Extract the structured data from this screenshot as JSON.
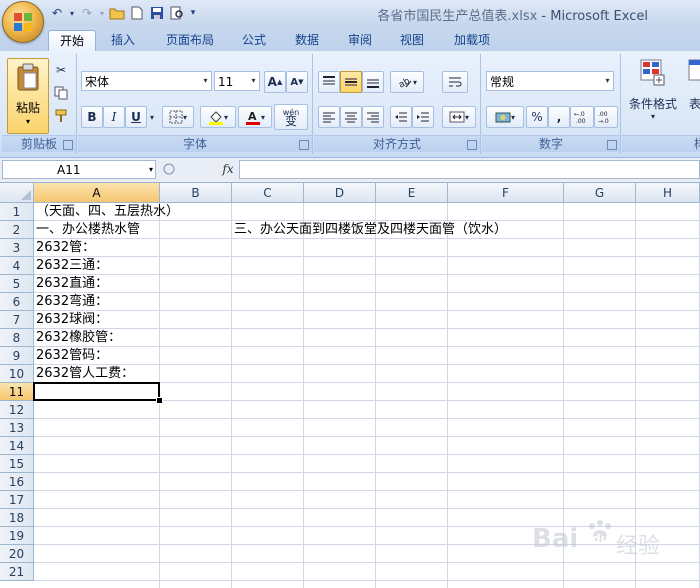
{
  "window": {
    "title_file": "各省市国民生产总值表.xlsx",
    "title_sep": " - ",
    "title_app": "Microsoft Excel"
  },
  "tabs": [
    {
      "label": "开始"
    },
    {
      "label": "插入"
    },
    {
      "label": "页面布局"
    },
    {
      "label": "公式"
    },
    {
      "label": "数据"
    },
    {
      "label": "审阅"
    },
    {
      "label": "视图"
    },
    {
      "label": "加载项"
    }
  ],
  "ribbon": {
    "clipboard": {
      "paste_label": "粘贴",
      "group_label": "剪贴板"
    },
    "font": {
      "name": "宋体",
      "size": "11",
      "group_label": "字体",
      "bold": "B",
      "italic": "I",
      "underline": "U",
      "wen": "wén",
      "bian": "变"
    },
    "alignment": {
      "group_label": "对齐方式"
    },
    "number": {
      "format": "常规",
      "group_label": "数字",
      "percent": "%",
      "comma": ",",
      "inc": "+.0\n.00",
      "dec": ".00\n→.0"
    },
    "styles": {
      "cond_format": "条件格式",
      "table_format_partial": "表格",
      "partial_label": "样"
    }
  },
  "formula_bar": {
    "name_box": "A11",
    "fx": "fx",
    "content": ""
  },
  "grid": {
    "columns": [
      "A",
      "B",
      "C",
      "D",
      "E",
      "F",
      "G",
      "H"
    ],
    "rows": [
      "1",
      "2",
      "3",
      "4",
      "5",
      "6",
      "7",
      "8",
      "9",
      "10",
      "11",
      "12",
      "13",
      "14",
      "15",
      "16",
      "17",
      "18",
      "19",
      "20",
      "21"
    ],
    "selected_column": "A",
    "selected_row": "11",
    "cells": {
      "A1": "（天面、四、五层热水）",
      "A2": "一、办公楼热水管",
      "C2": "三、办公天面到四楼饭堂及四楼天面管（饮水）",
      "A3": "2632管：",
      "A4": "2632三通：",
      "A5": "2632直通：",
      "A6": "2632弯通：",
      "A7": "2632球阀：",
      "A8": "2632橡胶管：",
      "A9": "2632管码：",
      "A10": "2632管人工费："
    }
  },
  "watermark": {
    "text": "Bai",
    "text2": "经验",
    "paw": "du"
  },
  "colors": {
    "accent": "#15428b",
    "selection": "#f6c670",
    "gridline": "#d0d7e5"
  }
}
